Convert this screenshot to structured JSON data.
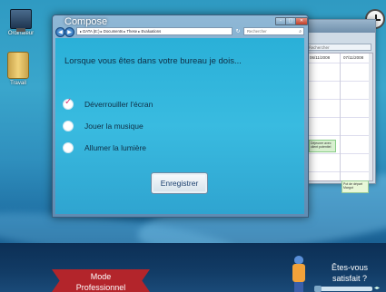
{
  "desktop": {
    "icons": [
      {
        "label": "Ordinateur"
      },
      {
        "label": "Travail"
      }
    ]
  },
  "calendar": {
    "search_placeholder": "Rechercher",
    "day_headers": [
      "06/11/2008",
      "07/11/2008"
    ],
    "events": [
      "Déjeuner avec client potentiel",
      "Pot de départ Margot"
    ]
  },
  "compose": {
    "title": "Compose",
    "address_path": "▸ DATA (E:) ▸ Documents ▸ These ▸ Evaluations",
    "search_placeholder": "Rechercher",
    "question": "Lorsque vous êtes dans votre bureau je dois...",
    "options": [
      {
        "label": "Déverrouiller l'écran",
        "selected": true
      },
      {
        "label": "Jouer la musique",
        "selected": false
      },
      {
        "label": "Allumer la lumière",
        "selected": false
      }
    ],
    "save_label": "Enregistrer"
  },
  "footer": {
    "mode_line1": "Mode",
    "mode_line2": "Professionnel",
    "satisfied_line1": "Êtes-vous",
    "satisfied_line2": "satisfait ?"
  }
}
